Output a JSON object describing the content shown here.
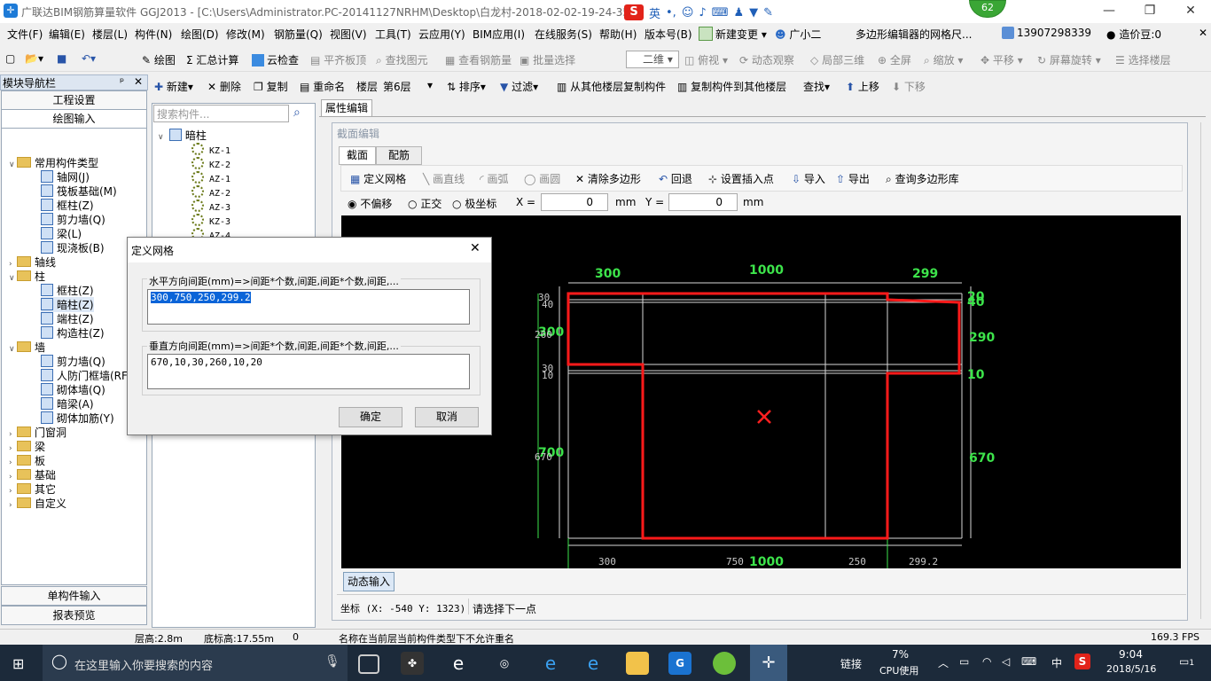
{
  "window": {
    "title": "广联达BIM钢筋算量软件 GGJ2013 - [C:\\Users\\Administrator.PC-20141127NRHM\\Desktop\\白龙村-2018-02-02-19-24-35",
    "ime_label": "英",
    "badge": "62"
  },
  "menubar": {
    "items": [
      "文件(F)",
      "编辑(E)",
      "楼层(L)",
      "构件(N)",
      "绘图(D)",
      "修改(M)",
      "钢筋量(Q)",
      "视图(V)",
      "工具(T)",
      "云应用(Y)",
      "BIM应用(I)",
      "在线服务(S)",
      "帮助(H)",
      "版本号(B)",
      "新建变更",
      "广小二",
      "多边形编辑器的网格尺...",
      "13907298339",
      "造价豆:0"
    ]
  },
  "toolbar1": {
    "items": [
      "绘图",
      "汇总计算",
      "云检查",
      "平齐板顶",
      "查找图元",
      "查看钢筋量",
      "批量选择",
      "二维",
      "俯视",
      "动态观察",
      "局部三维",
      "全屏",
      "缩放",
      "平移",
      "屏幕旋转",
      "选择楼层"
    ]
  },
  "nav": {
    "header": "模块导航栏",
    "btn_project": "工程设置",
    "btn_draw": "绘图输入",
    "btn_single": "单构件输入",
    "btn_report": "报表预览",
    "tree": [
      "常用构件类型",
      "轴网(J)",
      "筏板基础(M)",
      "框柱(Z)",
      "剪力墙(Q)",
      "梁(L)",
      "现浇板(B)",
      "轴线",
      "柱",
      "框柱(Z)",
      "暗柱(Z)",
      "端柱(Z)",
      "构造柱(Z)",
      "墙",
      "剪力墙(Q)",
      "人防门框墙(RF)",
      "砌体墙(Q)",
      "暗梁(A)",
      "砌体加筋(Y)",
      "门窗洞",
      "梁",
      "板",
      "基础",
      "其它",
      "自定义"
    ]
  },
  "toolbar2": {
    "items": [
      "新建",
      "删除",
      "复制",
      "重命名",
      "楼层",
      "第6层",
      "排序",
      "过滤",
      "从其他楼层复制构件",
      "复制构件到其他楼层",
      "查找",
      "上移",
      "下移"
    ]
  },
  "list": {
    "search_placeholder": "搜索构件...",
    "root": "暗柱",
    "items": [
      "KZ-1",
      "KZ-2",
      "AZ-1",
      "AZ-2",
      "AZ-3",
      "KZ-3",
      "AZ-4"
    ]
  },
  "attr_tab": "属性编辑",
  "editor": {
    "title": "截面编辑",
    "tabs": [
      "截面",
      "配筋"
    ],
    "tools": [
      "定义网格",
      "画直线",
      "画弧",
      "画圆",
      "清除多边形",
      "回退",
      "设置插入点",
      "导入",
      "导出",
      "查询多边形库"
    ],
    "modes": [
      "不偏移",
      "正交",
      "极坐标"
    ],
    "x_label": "X =",
    "y_label": "Y =",
    "x_value": "0",
    "y_value": "0",
    "unit": "mm",
    "dynamic_input": "动态输入",
    "coord": "坐标 (X: -540 Y: 1323)",
    "prompt": "请选择下一点"
  },
  "canvas": {
    "dims_green": [
      "300",
      "1000",
      "299",
      "300",
      "290",
      "700",
      "670",
      "20",
      "40",
      "10",
      "1000"
    ],
    "dims_small": [
      "30",
      "40",
      "30",
      "10",
      "670",
      "260",
      "300",
      "750",
      "250",
      "299.2"
    ]
  },
  "dialog": {
    "title": "定义网格",
    "h_label": "水平方向间距(mm)=>间距*个数,间距,间距*个数,间距,...",
    "h_value": "300,750,250,299.2",
    "v_label": "垂直方向间距(mm)=>间距*个数,间距,间距*个数,间距,...",
    "v_value": "670,10,30,260,10,20",
    "ok": "确定",
    "cancel": "取消"
  },
  "status": {
    "floor_height": "层高:2.8m",
    "base_height": "底标高:17.55m",
    "zero": "0",
    "message": "名称在当前层当前构件类型下不允许重名",
    "fps": "169.3 FPS"
  },
  "taskbar": {
    "search": "在这里输入你要搜索的内容",
    "link": "链接",
    "cpu_pct": "7%",
    "cpu_label": "CPU使用",
    "lang": "中",
    "time": "9:04",
    "date": "2018/5/16",
    "notif": "1"
  }
}
